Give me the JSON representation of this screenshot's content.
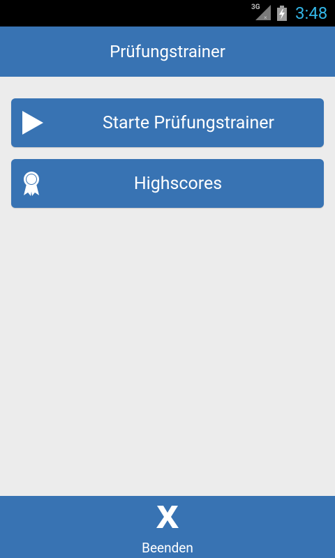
{
  "status_bar": {
    "network_label": "3G",
    "time": "3:48",
    "time_color": "#33b5e5"
  },
  "header": {
    "title": "Prüfungstrainer"
  },
  "menu": {
    "start_label": "Starte Prüfungstrainer",
    "start_icon": "play-icon",
    "highscores_label": "Highscores",
    "highscores_icon": "award-ribbon-icon"
  },
  "footer": {
    "quit_label": "Beenden",
    "quit_icon": "close-x-icon"
  },
  "colors": {
    "primary": "#3873b3",
    "background": "#ececec"
  }
}
